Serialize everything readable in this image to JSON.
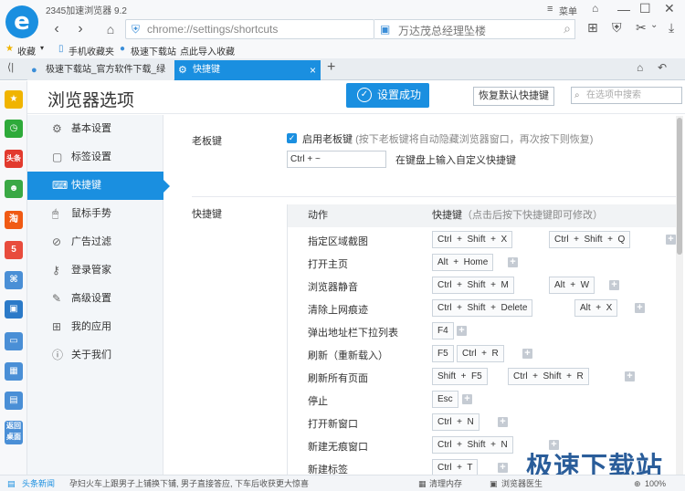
{
  "browser": {
    "title": "2345加速浏览器 9.2",
    "logo_glyph": "e",
    "address": "chrome://settings/shortcuts",
    "search_text": "万达茂总经理坠楼",
    "menu_label": "菜单",
    "nav": {
      "back": "‹",
      "forward": "›",
      "refresh": "↻",
      "home": "⌂"
    }
  },
  "bookmarks": {
    "items": [
      "收藏",
      "手机收藏夹",
      "极速下载站",
      "点此导入收藏"
    ]
  },
  "tabs": [
    {
      "label": "极速下载站_官方软件下载_绿色...",
      "close": "×"
    },
    {
      "label": "快捷键",
      "close": "×"
    }
  ],
  "page": {
    "title": "浏览器选项",
    "saved_label": "设置成功",
    "restore_label": "恢复默认快捷键",
    "search_placeholder": "在选项中搜索"
  },
  "sidebar": {
    "items": [
      {
        "label": "基本设置",
        "icon": "⚙"
      },
      {
        "label": "标签设置",
        "icon": "▢"
      },
      {
        "label": "快捷键",
        "icon": "⌨"
      },
      {
        "label": "鼠标手势",
        "icon": "🖱"
      },
      {
        "label": "广告过滤",
        "icon": "⊘"
      },
      {
        "label": "登录管家",
        "icon": "⚷"
      },
      {
        "label": "高级设置",
        "icon": "✎"
      },
      {
        "label": "我的应用",
        "icon": "⊞"
      },
      {
        "label": "关于我们",
        "icon": "ⓘ"
      }
    ]
  },
  "boss_key": {
    "section_label": "老板键",
    "enable_label": "启用老板键",
    "enable_hint": "(按下老板键将自动隐藏浏览器窗口，再次按下则恢复)",
    "input_value": "Ctrl + ~",
    "input_hint": "在键盘上输入自定义快捷键"
  },
  "shortcuts": {
    "section_label": "快捷键",
    "col_action": "动作",
    "col_shortcut": "快捷键",
    "col_hint": "（点击后按下快捷键即可修改）",
    "rows": [
      {
        "action": "指定区域截图",
        "keys": [
          "Ctrl + Shift + X",
          "Ctrl + Shift + Q"
        ]
      },
      {
        "action": "打开主页",
        "keys": [
          "Alt + Home"
        ]
      },
      {
        "action": "浏览器静音",
        "keys": [
          "Ctrl + Shift + M",
          "Alt + W"
        ]
      },
      {
        "action": "清除上网痕迹",
        "keys": [
          "Ctrl + Shift + Delete",
          "Alt + X"
        ]
      },
      {
        "action": "弹出地址栏下拉列表",
        "keys": [
          "F4"
        ]
      },
      {
        "action": "刷新（重新载入）",
        "keys": [
          "F5",
          "Ctrl + R"
        ]
      },
      {
        "action": "刷新所有页面",
        "keys": [
          "Shift + F5",
          "Ctrl + Shift + R"
        ]
      },
      {
        "action": "停止",
        "keys": [
          "Esc"
        ]
      },
      {
        "action": "打开新窗口",
        "keys": [
          "Ctrl + N"
        ]
      },
      {
        "action": "新建无痕窗口",
        "keys": [
          "Ctrl + Shift + N"
        ]
      },
      {
        "action": "新建标签",
        "keys": [
          "Ctrl + T"
        ]
      }
    ],
    "plus": "+"
  },
  "leftrail": {
    "items": [
      {
        "icon": "star-icon",
        "glyph": "★",
        "color": "#f0b400"
      },
      {
        "icon": "clock-icon",
        "glyph": "◷",
        "color": "#2eaa3a"
      },
      {
        "icon": "toutiao-icon",
        "glyph": "头条",
        "color": "#e23a2e"
      },
      {
        "icon": "game-icon",
        "glyph": "☻",
        "color": "#3aa845"
      },
      {
        "icon": "taobao-icon",
        "glyph": "淘",
        "color": "#f05a14"
      },
      {
        "icon": "5star-icon",
        "glyph": "5",
        "color": "#e84c3d"
      },
      {
        "icon": "gamepad-icon",
        "glyph": "⌘",
        "color": "#4a8fd6"
      },
      {
        "icon": "film-icon",
        "glyph": "▣",
        "color": "#2b7ac8"
      },
      {
        "icon": "computer-icon",
        "glyph": "▭",
        "color": "#4a8fd6"
      },
      {
        "icon": "calculator-icon",
        "glyph": "▦",
        "color": "#4a8fd6"
      },
      {
        "icon": "book-icon",
        "glyph": "▤",
        "color": "#4a8fd6"
      },
      {
        "icon": "back-desktop-icon",
        "glyph": "返回桌面",
        "color": "#4a8fd6"
      }
    ]
  },
  "status": {
    "news_label": "头条新闻",
    "news_text": "孕妇火车上跟男子上铺换下铺, 男子直接答应, 下车后收获更大惊喜",
    "clean_label": "清理内存",
    "doctor_label": "浏览器医生",
    "zoom": "100%"
  },
  "watermark": "极速下载站",
  "colors": {
    "accent": "#1a8fe0"
  }
}
